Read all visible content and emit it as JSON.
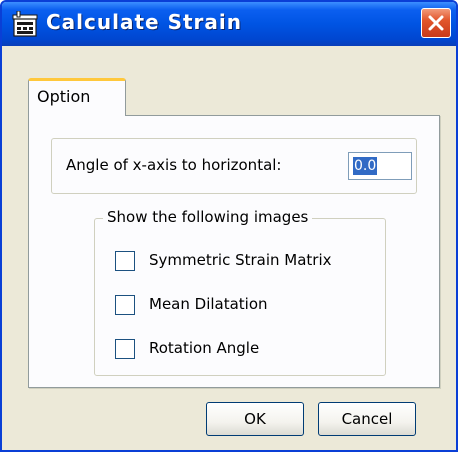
{
  "window": {
    "title": "Calculate Strain"
  },
  "icons": {
    "app": "calculator-app-icon",
    "close": "close-icon"
  },
  "colors": {
    "titlebar": "#0054e3",
    "close_button": "#e2562c",
    "tab_highlight": "#ffc83c",
    "selection": "#316ac5",
    "dialog_background": "#ece9d8"
  },
  "tabs": [
    {
      "label": "Option",
      "selected": true
    }
  ],
  "angle": {
    "label": "Angle of x-axis to horizontal:",
    "value": "0.0"
  },
  "images_group": {
    "legend": "Show the following images",
    "options": [
      {
        "label": "Symmetric Strain Matrix",
        "checked": false
      },
      {
        "label": "Mean Dilatation",
        "checked": false
      },
      {
        "label": "Rotation Angle",
        "checked": false
      }
    ]
  },
  "buttons": {
    "ok": "OK",
    "cancel": "Cancel"
  }
}
